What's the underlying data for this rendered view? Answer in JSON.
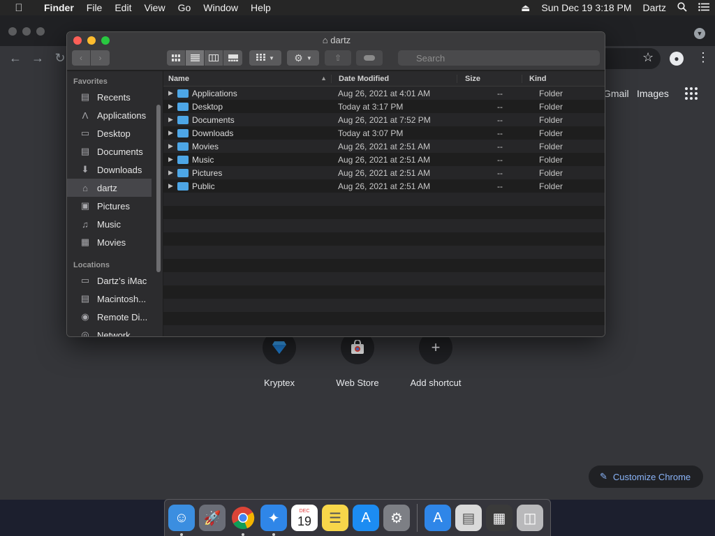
{
  "menubar": {
    "apple_icon": "apple-icon",
    "app_name": "Finder",
    "menus": [
      "File",
      "Edit",
      "View",
      "Go",
      "Window",
      "Help"
    ],
    "datetime": "Sun Dec 19  3:18 PM",
    "user": "Dartz"
  },
  "chrome": {
    "links": {
      "gmail": "Gmail",
      "images": "Images"
    },
    "shortcuts": [
      {
        "label": "Kryptex",
        "icon": "kryptex-icon"
      },
      {
        "label": "Web Store",
        "icon": "web-store-icon"
      },
      {
        "label": "Add shortcut",
        "icon": "plus-icon"
      }
    ],
    "customize_label": "Customize Chrome"
  },
  "finder": {
    "title": "dartz",
    "search_placeholder": "Search",
    "sidebar": {
      "favorites_header": "Favorites",
      "favorites": [
        {
          "label": "Recents",
          "icon": "clock-icon"
        },
        {
          "label": "Applications",
          "icon": "applications-icon"
        },
        {
          "label": "Desktop",
          "icon": "desktop-icon"
        },
        {
          "label": "Documents",
          "icon": "documents-icon"
        },
        {
          "label": "Downloads",
          "icon": "downloads-icon"
        },
        {
          "label": "dartz",
          "icon": "home-icon",
          "selected": true
        },
        {
          "label": "Pictures",
          "icon": "camera-icon"
        },
        {
          "label": "Music",
          "icon": "music-icon"
        },
        {
          "label": "Movies",
          "icon": "film-icon"
        }
      ],
      "locations_header": "Locations",
      "locations": [
        {
          "label": "Dartz’s iMac",
          "icon": "imac-icon"
        },
        {
          "label": "Macintosh...",
          "icon": "hard-drive-icon"
        },
        {
          "label": "Remote Di...",
          "icon": "disc-icon"
        },
        {
          "label": "Network",
          "icon": "network-icon"
        }
      ]
    },
    "columns": {
      "name": "Name",
      "date": "Date Modified",
      "size": "Size",
      "kind": "Kind"
    },
    "rows": [
      {
        "name": "Applications",
        "date": "Aug 26, 2021 at 4:01 AM",
        "size": "--",
        "kind": "Folder"
      },
      {
        "name": "Desktop",
        "date": "Today at 3:17 PM",
        "size": "--",
        "kind": "Folder"
      },
      {
        "name": "Documents",
        "date": "Aug 26, 2021 at 7:52 PM",
        "size": "--",
        "kind": "Folder"
      },
      {
        "name": "Downloads",
        "date": "Today at 3:07 PM",
        "size": "--",
        "kind": "Folder"
      },
      {
        "name": "Movies",
        "date": "Aug 26, 2021 at 2:51 AM",
        "size": "--",
        "kind": "Folder"
      },
      {
        "name": "Music",
        "date": "Aug 26, 2021 at 2:51 AM",
        "size": "--",
        "kind": "Folder"
      },
      {
        "name": "Pictures",
        "date": "Aug 26, 2021 at 2:51 AM",
        "size": "--",
        "kind": "Folder"
      },
      {
        "name": "Public",
        "date": "Aug 26, 2021 at 2:51 AM",
        "size": "--",
        "kind": "Folder"
      }
    ],
    "empty_rows": 11
  },
  "dock": {
    "items": [
      {
        "name": "finder",
        "color": "#3b8ee0",
        "running": true
      },
      {
        "name": "launchpad",
        "color": "#6b6e78",
        "running": false
      },
      {
        "name": "chrome",
        "color": "#ffffff",
        "running": true
      },
      {
        "name": "safari",
        "color": "#2f86e8",
        "running": true
      },
      {
        "name": "calendar",
        "color": "#ffffff",
        "running": false,
        "month": "DEC",
        "day": "19"
      },
      {
        "name": "notes",
        "color": "#f7d64a",
        "running": false
      },
      {
        "name": "app-store",
        "color": "#1c8cf2",
        "running": false
      },
      {
        "name": "system-preferences",
        "color": "#7d7f85",
        "running": false
      }
    ],
    "right_items": [
      {
        "name": "applications-folder",
        "color": "#2f86e8"
      },
      {
        "name": "document-stack",
        "color": "#d9d9d9"
      },
      {
        "name": "screenshot-stack",
        "color": "#3a3a3a"
      },
      {
        "name": "trash",
        "color": "#b9b9bb"
      }
    ]
  }
}
